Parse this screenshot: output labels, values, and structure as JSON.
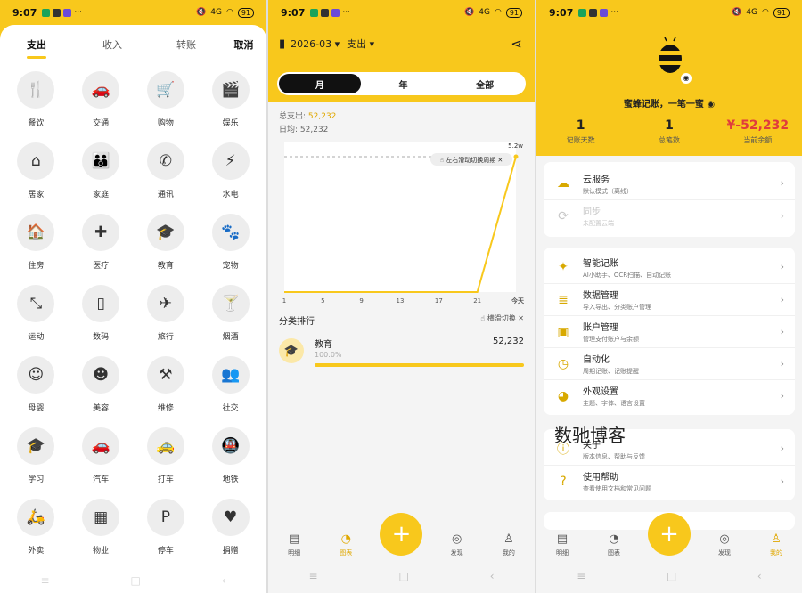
{
  "status": {
    "time": "9:07",
    "battery": "91",
    "network": "4G"
  },
  "entry": {
    "tabs": [
      "支出",
      "收入",
      "转账"
    ],
    "cancel": "取消",
    "categories": [
      {
        "label": "餐饮",
        "icon": "🍴"
      },
      {
        "label": "交通",
        "icon": "🚗"
      },
      {
        "label": "购物",
        "icon": "🛒"
      },
      {
        "label": "娱乐",
        "icon": "🎬"
      },
      {
        "label": "居家",
        "icon": "⌂"
      },
      {
        "label": "家庭",
        "icon": "👪"
      },
      {
        "label": "通讯",
        "icon": "✆"
      },
      {
        "label": "水电",
        "icon": "⚡"
      },
      {
        "label": "住房",
        "icon": "🏠"
      },
      {
        "label": "医疗",
        "icon": "✚"
      },
      {
        "label": "教育",
        "icon": "🎓"
      },
      {
        "label": "宠物",
        "icon": "🐾"
      },
      {
        "label": "运动",
        "icon": "⤡"
      },
      {
        "label": "数码",
        "icon": "▯"
      },
      {
        "label": "旅行",
        "icon": "✈"
      },
      {
        "label": "烟酒",
        "icon": "🍸"
      },
      {
        "label": "母婴",
        "icon": "☺"
      },
      {
        "label": "美容",
        "icon": "☻"
      },
      {
        "label": "维修",
        "icon": "⚒"
      },
      {
        "label": "社交",
        "icon": "👥"
      },
      {
        "label": "学习",
        "icon": "🎓"
      },
      {
        "label": "汽车",
        "icon": "🚗"
      },
      {
        "label": "打车",
        "icon": "🚕"
      },
      {
        "label": "地铁",
        "icon": "🚇"
      },
      {
        "label": "外卖",
        "icon": "🛵"
      },
      {
        "label": "物业",
        "icon": "▦"
      },
      {
        "label": "停车",
        "icon": "P"
      },
      {
        "label": "捐赠",
        "icon": "♥"
      }
    ]
  },
  "stats": {
    "period": "2026-03",
    "type": "支出",
    "segments": [
      "月",
      "年",
      "全部"
    ],
    "total_label": "总支出:",
    "total_value": "52,232",
    "avg_label": "日均:",
    "avg_value": "52,232",
    "chart_hint": "左右滑动切换周期",
    "rank_title": "分类排行",
    "rank_hint": "横滑切换",
    "rank": [
      {
        "name": "教育",
        "value": "52,232",
        "pct": "100.0%"
      }
    ]
  },
  "chart_data": {
    "type": "line",
    "x": [
      "1",
      "5",
      "9",
      "13",
      "17",
      "21",
      "今天"
    ],
    "series": [
      {
        "values": [
          0,
          0,
          0,
          0,
          0,
          0,
          52232
        ]
      }
    ],
    "ymax_label": "5.2w",
    "ylim": [
      0,
      52232
    ]
  },
  "nav": [
    {
      "label": "明细",
      "icon": "▤"
    },
    {
      "label": "图表",
      "icon": "◔"
    },
    {
      "label": "",
      "icon": "+"
    },
    {
      "label": "发现",
      "icon": "◎"
    },
    {
      "label": "我的",
      "icon": "♙"
    }
  ],
  "profile": {
    "app_name": "蜜蜂记账，一笔一蜜",
    "days": "1",
    "days_label": "记账天数",
    "count": "1",
    "count_label": "总笔数",
    "balance": "¥-52,232",
    "balance_label": "当前余额",
    "card1": [
      {
        "title": "云服务",
        "sub": "默认模式（离线）",
        "icon": "☁"
      },
      {
        "title": "同步",
        "sub": "未配置云端",
        "icon": "⟳"
      }
    ],
    "card2": [
      {
        "title": "智能记账",
        "sub": "AI小助手、OCR扫描、自动记账",
        "icon": "✦"
      },
      {
        "title": "数据管理",
        "sub": "导入导出、分类账户管理",
        "icon": "≣"
      },
      {
        "title": "账户管理",
        "sub": "管理支付账户与余额",
        "icon": "▣"
      },
      {
        "title": "自动化",
        "sub": "周期记账、记账提醒",
        "icon": "◷"
      },
      {
        "title": "外观设置",
        "sub": "主题、字体、语言设置",
        "icon": "◕"
      }
    ],
    "card3": [
      {
        "title": "关于",
        "sub": "版本信息、帮助与反馈",
        "icon": "ⓘ"
      },
      {
        "title": "使用帮助",
        "sub": "查看使用文档和常见问题",
        "icon": "?"
      }
    ],
    "watermark": "数驰博客"
  },
  "sysnav": [
    "≡",
    "□",
    "‹"
  ]
}
